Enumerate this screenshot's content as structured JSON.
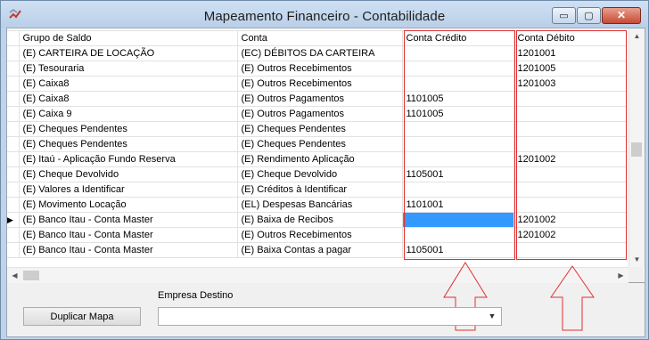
{
  "window": {
    "title": "Mapeamento Financeiro - Contabilidade",
    "controls": {
      "minimize": "▭",
      "maximize": "▢",
      "close": "✕"
    }
  },
  "grid": {
    "columns": [
      "Grupo de Saldo",
      "Conta",
      "Conta Crédito",
      "Conta Débito"
    ],
    "current_row_marker": "▶",
    "rows": [
      {
        "grupo": "(E) CARTEIRA DE LOCAÇÃO",
        "conta": "(EC) DÉBITOS DA CARTEIRA",
        "credito": "",
        "debito": "1201001"
      },
      {
        "grupo": "(E) Tesouraria",
        "conta": "(E) Outros Recebimentos",
        "credito": "",
        "debito": "1201005"
      },
      {
        "grupo": "(E) Caixa8",
        "conta": "(E) Outros Recebimentos",
        "credito": "",
        "debito": "1201003"
      },
      {
        "grupo": "(E) Caixa8",
        "conta": "(E) Outros Pagamentos",
        "credito": "1101005",
        "debito": ""
      },
      {
        "grupo": "(E) Caixa 9",
        "conta": "(E) Outros Pagamentos",
        "credito": "1101005",
        "debito": ""
      },
      {
        "grupo": "(E) Cheques Pendentes",
        "conta": "(E) Cheques Pendentes",
        "credito": "",
        "debito": ""
      },
      {
        "grupo": "(E) Cheques Pendentes",
        "conta": "(E) Cheques Pendentes",
        "credito": "",
        "debito": ""
      },
      {
        "grupo": "(E) Itaú - Aplicação Fundo Reserva",
        "conta": "(E) Rendimento Aplicação",
        "credito": "",
        "debito": "1201002"
      },
      {
        "grupo": "(E) Cheque Devolvido",
        "conta": "(E) Cheque Devolvido",
        "credito": "1105001",
        "debito": ""
      },
      {
        "grupo": "(E) Valores a Identificar",
        "conta": "(E) Créditos à Identificar",
        "credito": "",
        "debito": ""
      },
      {
        "grupo": "(E) Movimento Locação",
        "conta": "(EL) Despesas Bancárias",
        "credito": "1101001",
        "debito": ""
      },
      {
        "grupo": "(E) Banco Itau - Conta Master",
        "conta": "(E) Baixa de Recibos",
        "credito": "",
        "debito": "1201002",
        "current": true
      },
      {
        "grupo": "(E) Banco Itau - Conta Master",
        "conta": "(E) Outros Recebimentos",
        "credito": "",
        "debito": "1201002"
      },
      {
        "grupo": "(E) Banco Itau - Conta Master",
        "conta": "(E) Baixa Contas a pagar",
        "credito": "1105001",
        "debito": ""
      }
    ]
  },
  "form": {
    "duplicate_button": "Duplicar Mapa",
    "empresa_label": "Empresa Destino",
    "empresa_value": ""
  },
  "colors": {
    "highlight": "#e03030",
    "selection": "#3399ff"
  },
  "icons": [
    "app-icon",
    "scroll-up-icon",
    "scroll-down-icon",
    "scroll-left-icon",
    "scroll-right-icon",
    "dropdown-arrow-icon"
  ]
}
